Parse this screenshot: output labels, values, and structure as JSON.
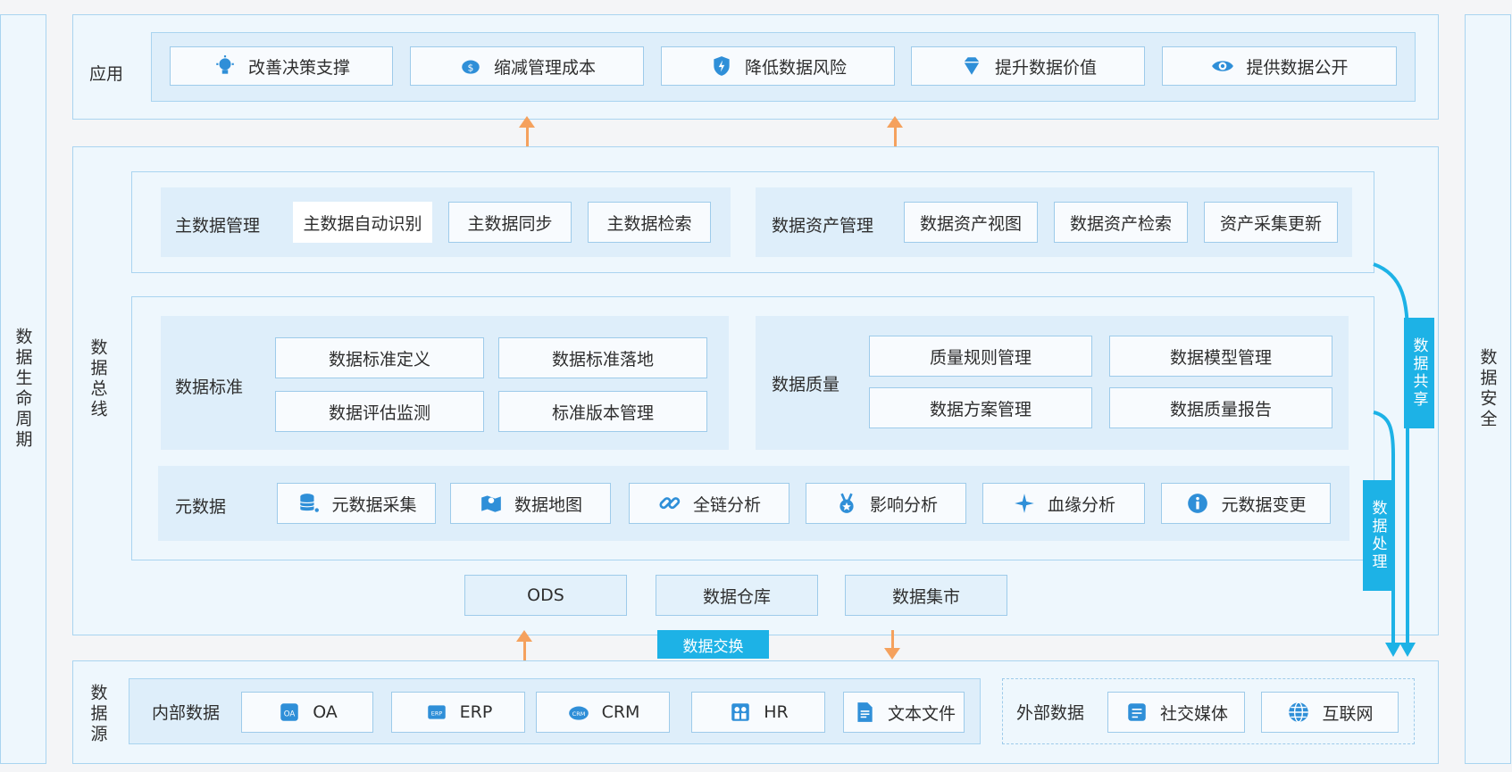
{
  "left_side": {
    "label": "数据生命周期"
  },
  "right_side": {
    "label": "数据安全"
  },
  "apps": {
    "label": "应用",
    "items": [
      {
        "label": "改善决策支撑",
        "icon": "lightbulb-icon"
      },
      {
        "label": "缩减管理成本",
        "icon": "piggy-bank-icon"
      },
      {
        "label": "降低数据风险",
        "icon": "shield-icon"
      },
      {
        "label": "提升数据价值",
        "icon": "diamond-icon"
      },
      {
        "label": "提供数据公开",
        "icon": "eye-icon"
      }
    ]
  },
  "bus": {
    "label": "数据总线",
    "master": {
      "label": "主数据管理",
      "items": [
        "主数据自动识别",
        "主数据同步",
        "主数据检索"
      ]
    },
    "asset": {
      "label": "数据资产管理",
      "items": [
        "数据资产视图",
        "数据资产检索",
        "资产采集更新"
      ]
    },
    "standard": {
      "label": "数据标准",
      "items": [
        "数据标准定义",
        "数据标准落地",
        "数据评估监测",
        "标准版本管理"
      ]
    },
    "quality": {
      "label": "数据质量",
      "items": [
        "质量规则管理",
        "数据模型管理",
        "数据方案管理",
        "数据质量报告"
      ]
    },
    "meta": {
      "label": "元数据",
      "items": [
        {
          "label": "元数据采集",
          "icon": "database-icon"
        },
        {
          "label": "数据地图",
          "icon": "map-icon"
        },
        {
          "label": "全链分析",
          "icon": "link-icon"
        },
        {
          "label": "影响分析",
          "icon": "medal-icon"
        },
        {
          "label": "血缘分析",
          "icon": "star-icon"
        },
        {
          "label": "元数据变更",
          "icon": "info-circle-icon"
        }
      ]
    },
    "storage": [
      "ODS",
      "数据仓库",
      "数据集市"
    ]
  },
  "exchange": {
    "label": "数据交换"
  },
  "share": {
    "label": "数据共享"
  },
  "process": {
    "label": "数据处理"
  },
  "sources": {
    "label": "数据源",
    "internal": {
      "label": "内部数据",
      "items": [
        {
          "label": "OA",
          "icon": "oa-icon"
        },
        {
          "label": "ERP",
          "icon": "erp-icon"
        },
        {
          "label": "CRM",
          "icon": "crm-icon"
        },
        {
          "label": "HR",
          "icon": "hr-icon"
        },
        {
          "label": "文本文件",
          "icon": "document-icon"
        }
      ]
    },
    "external": {
      "label": "外部数据",
      "items": [
        {
          "label": "社交媒体",
          "icon": "social-media-icon"
        },
        {
          "label": "互联网",
          "icon": "globe-icon"
        }
      ]
    }
  },
  "colors": {
    "accent": "#1db2e6",
    "arrow": "#f5a15d",
    "icon": "#2f8fd8",
    "border": "#a9d4f0"
  }
}
